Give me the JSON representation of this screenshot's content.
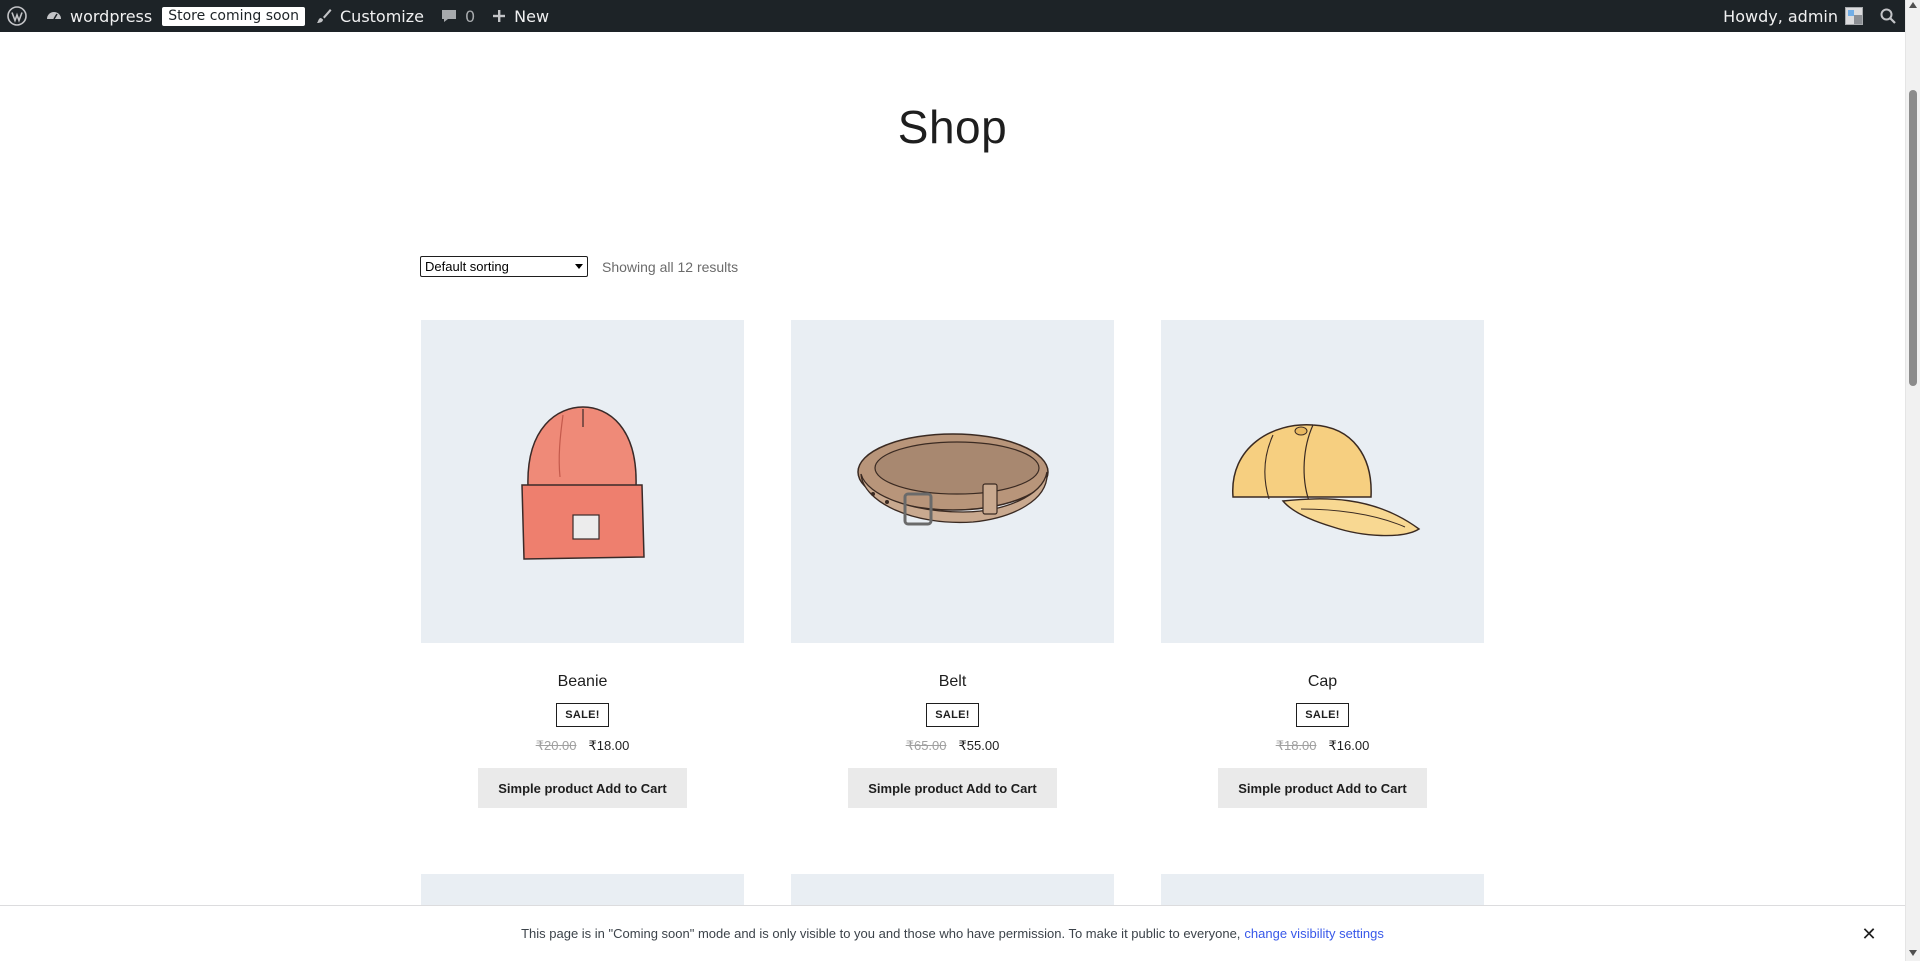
{
  "adminbar": {
    "site_name": "wordpress",
    "store_badge": "Store coming soon",
    "customize": "Customize",
    "comments_count": "0",
    "new_label": "New",
    "greeting": "Howdy, admin"
  },
  "page": {
    "title": "Shop"
  },
  "toolbar": {
    "sort_selected": "Default sorting",
    "result_count": "Showing all 12 results"
  },
  "products": [
    {
      "name": "Beanie",
      "badge": "SALE!",
      "old_price": "₹20.00",
      "price": "₹18.00",
      "button": "Simple product Add to Cart",
      "icon": "beanie-image"
    },
    {
      "name": "Belt",
      "badge": "SALE!",
      "old_price": "₹65.00",
      "price": "₹55.00",
      "button": "Simple product Add to Cart",
      "icon": "belt-image"
    },
    {
      "name": "Cap",
      "badge": "SALE!",
      "old_price": "₹18.00",
      "price": "₹16.00",
      "button": "Simple product Add to Cart",
      "icon": "cap-image"
    }
  ],
  "notice": {
    "text": "This page is in \"Coming soon\" mode and is only visible to you and those who have permission. To make it public to everyone,",
    "link": "change visibility settings"
  },
  "colors": {
    "adminbar_bg": "#1d2327",
    "product_bg": "#e9eef3",
    "link": "#3858e9",
    "button_bg": "#eaeaea"
  }
}
